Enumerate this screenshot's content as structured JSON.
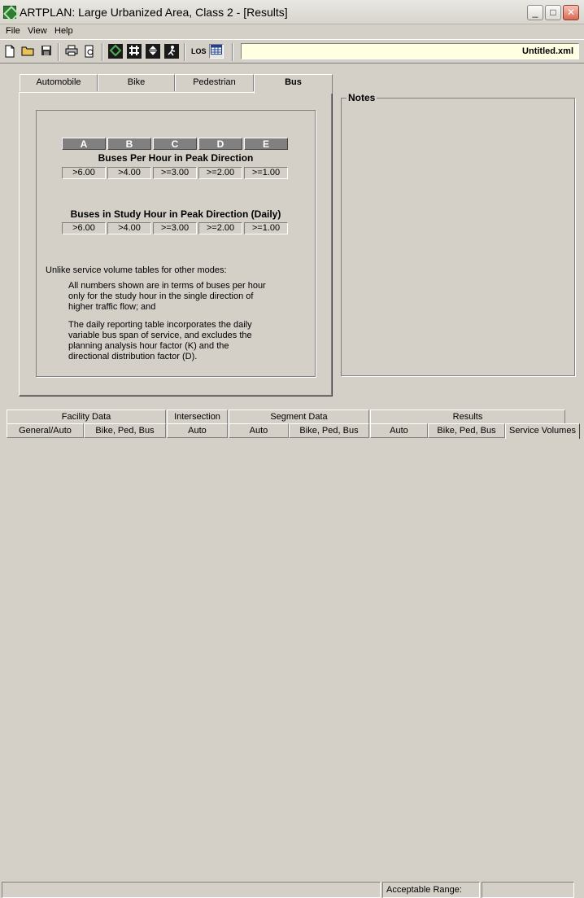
{
  "window": {
    "title": "ARTPLAN: Large Urbanized Area, Class 2 - [Results]",
    "minimize_glyph": "_",
    "maximize_glyph": "□",
    "close_glyph": "✕"
  },
  "menu": [
    "File",
    "View",
    "Help"
  ],
  "toolbar": {
    "icons": [
      "new-file-icon",
      "open-folder-icon",
      "save-disk-icon",
      "print-icon",
      "print-preview-icon",
      "grid-a-icon",
      "grid-b-icon",
      "grid-c-icon",
      "grid-d-icon",
      "los-icon",
      "table-icon"
    ],
    "los_label": "LOS",
    "filename": "Untitled.xml"
  },
  "tabs": [
    {
      "label": "Automobile",
      "active": false
    },
    {
      "label": "Bike",
      "active": false
    },
    {
      "label": "Pedestrian",
      "active": false
    },
    {
      "label": "Bus",
      "active": true
    }
  ],
  "bus": {
    "grades": [
      "A",
      "B",
      "C",
      "D",
      "E"
    ],
    "peak_title": "Buses Per Hour in Peak Direction",
    "peak_values": [
      ">6.00",
      ">4.00",
      ">=3.00",
      ">=2.00",
      ">=1.00"
    ],
    "daily_title": "Buses in Study Hour in Peak Direction (Daily)",
    "daily_values": [
      ">6.00",
      ">4.00",
      ">=3.00",
      ">=2.00",
      ">=1.00"
    ],
    "note_intro": "Unlike service volume tables for other modes:",
    "note_1": [
      "All numbers shown are in terms of buses per hour",
      "only for the study hour in the single direction of",
      "higher traffic flow; and"
    ],
    "note_2": [
      "The daily reporting table incorporates the daily",
      "variable bus span of service, and excludes the",
      "planning analysis hour factor (K) and the",
      "directional distribution factor (D)."
    ]
  },
  "notes": {
    "label": "Notes"
  },
  "bottom_tabs": {
    "groups": [
      {
        "label": "Facility Data",
        "subs": [
          "General/Auto",
          "Bike, Ped, Bus"
        ]
      },
      {
        "label": "Intersection",
        "subs": [
          "Auto"
        ]
      },
      {
        "label": "Segment Data",
        "subs": [
          "Auto",
          "Bike, Ped, Bus"
        ]
      },
      {
        "label": "Results",
        "subs": [
          "Auto",
          "Bike, Ped, Bus",
          "Service Volumes"
        ]
      }
    ]
  },
  "status": {
    "range_label": "Acceptable Range:",
    "range_value": ""
  }
}
